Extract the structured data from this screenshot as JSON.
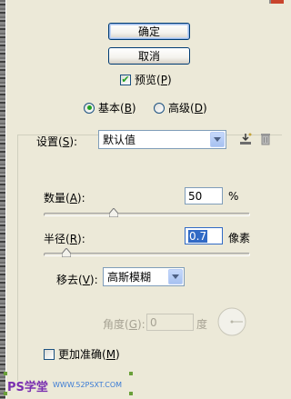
{
  "buttons": {
    "ok": "确定",
    "cancel": "取消"
  },
  "preview": {
    "label": "预览(",
    "hotkey": "P",
    "suffix": ")",
    "checked": true
  },
  "mode": {
    "basic": {
      "label": "基本(",
      "hotkey": "B",
      "suffix": ")",
      "selected": true
    },
    "advanced": {
      "label": "高级(",
      "hotkey": "D",
      "suffix": ")",
      "selected": false
    }
  },
  "settings": {
    "label": "设置(",
    "hotkey": "S",
    "suffix": "):",
    "value": "默认值"
  },
  "amount": {
    "label": "数量(",
    "hotkey": "A",
    "suffix": "):",
    "value": "50",
    "unit": "%",
    "slider_fraction": 0.33
  },
  "radius": {
    "label": "半径(",
    "hotkey": "R",
    "suffix": "):",
    "value": "0.7",
    "unit": "像素",
    "slider_fraction": 0.09
  },
  "remove": {
    "label": "移去(",
    "hotkey": "V",
    "suffix": "):",
    "value": "高斯模糊"
  },
  "angle": {
    "label": "角度(",
    "hotkey": "G",
    "suffix": "):",
    "value": "0",
    "unit": "度"
  },
  "more_accurate": {
    "label": "更加准确(",
    "hotkey": "M",
    "suffix": ")",
    "checked": false
  },
  "watermark": {
    "text": "PS学堂",
    "site": "WWW.52PSXT.COM"
  },
  "colors": {
    "dialog_bg": "#ece9d8",
    "accent_border": "#003c74",
    "check_green": "#21a121"
  }
}
